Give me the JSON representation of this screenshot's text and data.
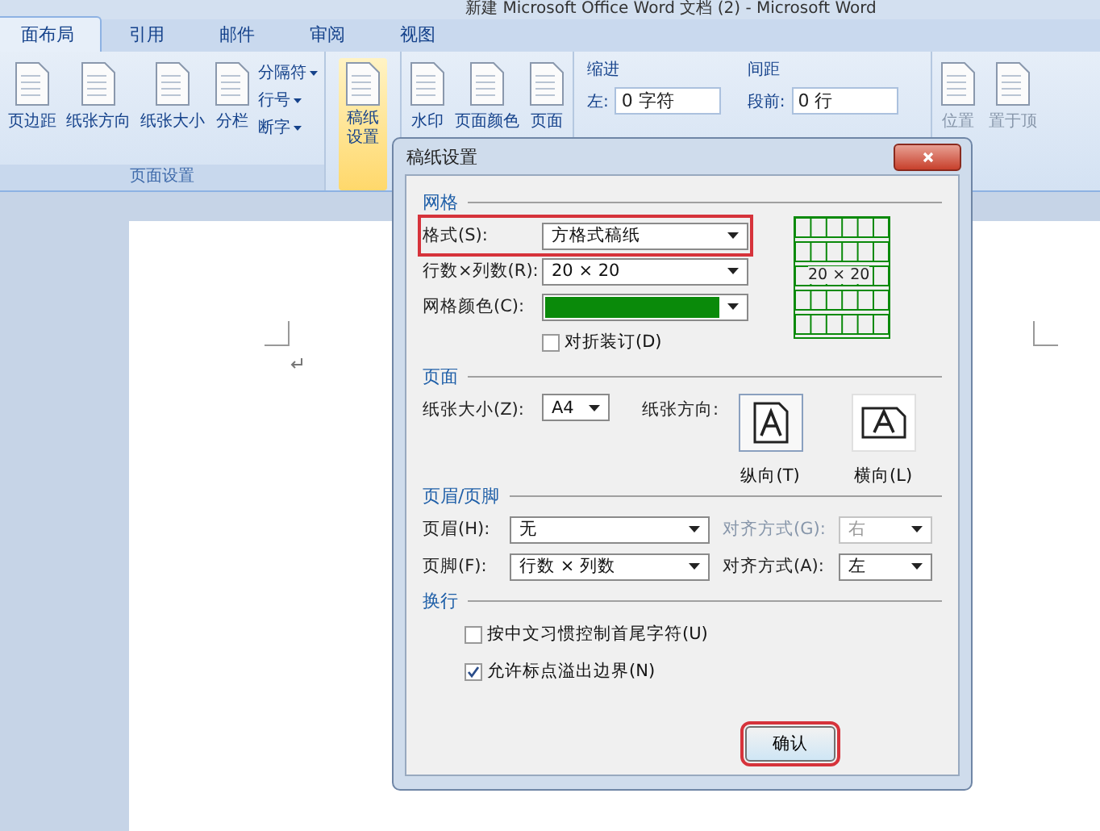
{
  "window": {
    "title": "新建 Microsoft Office Word 文档 (2) - Microsoft Word"
  },
  "tabs": [
    {
      "label": "面布局",
      "selected": true
    },
    {
      "label": "引用",
      "selected": false
    },
    {
      "label": "邮件",
      "selected": false
    },
    {
      "label": "审阅",
      "selected": false
    },
    {
      "label": "视图",
      "selected": false
    }
  ],
  "page_setup_group": {
    "label": "页面设置",
    "large_buttons": [
      "页边距",
      "纸张方向",
      "纸张大小",
      "分栏"
    ],
    "small_buttons": [
      "分隔符",
      "行号",
      "断字"
    ]
  },
  "manuscript_button": {
    "label": "稿纸设置",
    "highlighted": true
  },
  "background_buttons": [
    "水印",
    "页面颜色",
    "页面"
  ],
  "indent": {
    "label": "缩进",
    "field_label": "左:",
    "value": "0 字符"
  },
  "spacing": {
    "label": "间距",
    "field_label": "段前:",
    "value": "0 行"
  },
  "arrange_buttons": [
    "位置",
    "置于顶"
  ],
  "dialog": {
    "title": "稿纸设置",
    "grid_section": {
      "label": "网格",
      "style": {
        "label": "格式(S):",
        "value": "方格式稿纸",
        "highlighted": true
      },
      "size": {
        "label": "行数×列数(R):",
        "value": "20 × 20"
      },
      "grid_color": {
        "label": "网格颜色(C):",
        "color": "#0a8a0a"
      },
      "fold": {
        "label": "对折装订(D)",
        "checked": false
      },
      "preview_label": "20 × 20"
    },
    "page_section": {
      "label": "页面",
      "paper_size": {
        "label": "纸张大小(Z):",
        "value": "A4"
      },
      "orientation_label": "纸张方向:",
      "orientations": [
        {
          "label": "纵向(T)",
          "kind": "portrait",
          "selected": true
        },
        {
          "label": "横向(L)",
          "kind": "landscape",
          "selected": false
        }
      ]
    },
    "header_footer_section": {
      "label": "页眉/页脚",
      "rows": [
        {
          "label": "页眉(H):",
          "value": "无",
          "align_label": "对齐方式(G):",
          "align_value": "右",
          "disabled": true
        },
        {
          "label": "页脚(F):",
          "value": "行数 × 列数",
          "align_label": "对齐方式(A):",
          "align_value": "左",
          "disabled": false
        }
      ]
    },
    "wrap_section": {
      "label": "换行",
      "options": [
        {
          "label": "按中文习惯控制首尾字符(U)",
          "checked": false
        },
        {
          "label": "允许标点溢出边界(N)",
          "checked": true
        }
      ]
    },
    "ok_button": {
      "label": "确认",
      "highlighted": true
    }
  }
}
